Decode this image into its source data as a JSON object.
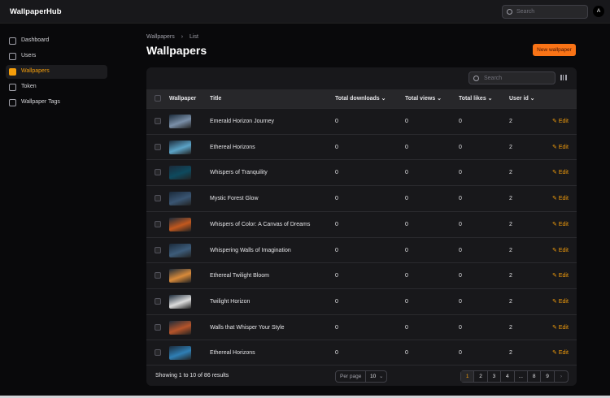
{
  "header": {
    "brand": "WallpaperHub",
    "search_placeholder": "Search",
    "avatar": "A"
  },
  "sidebar": {
    "items": [
      {
        "label": "Dashboard",
        "icon": "home-icon"
      },
      {
        "label": "Users",
        "icon": "users-icon"
      },
      {
        "label": "Wallpapers",
        "icon": "image-icon",
        "active": true
      },
      {
        "label": "Token",
        "icon": "fingerprint-icon"
      },
      {
        "label": "Wallpaper Tags",
        "icon": "tag-icon"
      }
    ]
  },
  "breadcrumb": {
    "parent": "Wallpapers",
    "sep": "›",
    "current": "List"
  },
  "page": {
    "title": "Wallpapers",
    "new_button": "New wallpaper"
  },
  "table": {
    "search_placeholder": "Search",
    "columns": {
      "wallpaper": "Wallpaper",
      "title": "Title",
      "downloads": "Total downloads",
      "views": "Total views",
      "likes": "Total likes",
      "user": "User id"
    },
    "edit_label": "Edit",
    "rows": [
      {
        "title": "Emerald Horizon Journey",
        "downloads": "0",
        "views": "0",
        "likes": "0",
        "user": "2",
        "color": "#7a8fa8"
      },
      {
        "title": "Ethereal Horizons",
        "downloads": "0",
        "views": "0",
        "likes": "0",
        "user": "2",
        "color": "#5ba3c7"
      },
      {
        "title": "Whispers of Tranquility",
        "downloads": "0",
        "views": "0",
        "likes": "0",
        "user": "2",
        "color": "#0e4a5e"
      },
      {
        "title": "Mystic Forest Glow",
        "downloads": "0",
        "views": "0",
        "likes": "0",
        "user": "2",
        "color": "#3a5572"
      },
      {
        "title": "Whispers of Color: A Canvas of Dreams",
        "downloads": "0",
        "views": "0",
        "likes": "0",
        "user": "2",
        "color": "#c2581e"
      },
      {
        "title": "Whispering Walls of Imagination",
        "downloads": "0",
        "views": "0",
        "likes": "0",
        "user": "2",
        "color": "#3d5c7a"
      },
      {
        "title": "Ethereal Twilight Bloom",
        "downloads": "0",
        "views": "0",
        "likes": "0",
        "user": "2",
        "color": "#d88a3a"
      },
      {
        "title": "Twilight Horizon",
        "downloads": "0",
        "views": "0",
        "likes": "0",
        "user": "2",
        "color": "#dcdcdc"
      },
      {
        "title": "Walls that Whisper Your Style",
        "downloads": "0",
        "views": "0",
        "likes": "0",
        "user": "2",
        "color": "#b5542a"
      },
      {
        "title": "Ethereal Horizons",
        "downloads": "0",
        "views": "0",
        "likes": "0",
        "user": "2",
        "color": "#2f7fb5"
      }
    ]
  },
  "footer": {
    "summary": "Showing 1 to 10 of 86 results",
    "per_page_label": "Per page",
    "per_page_value": "10",
    "pages": [
      "1",
      "2",
      "3",
      "4",
      "...",
      "8",
      "9"
    ],
    "current_page": "1",
    "next": "›"
  },
  "colors": {
    "accent": "#f59e0b",
    "button": "#f97316"
  }
}
